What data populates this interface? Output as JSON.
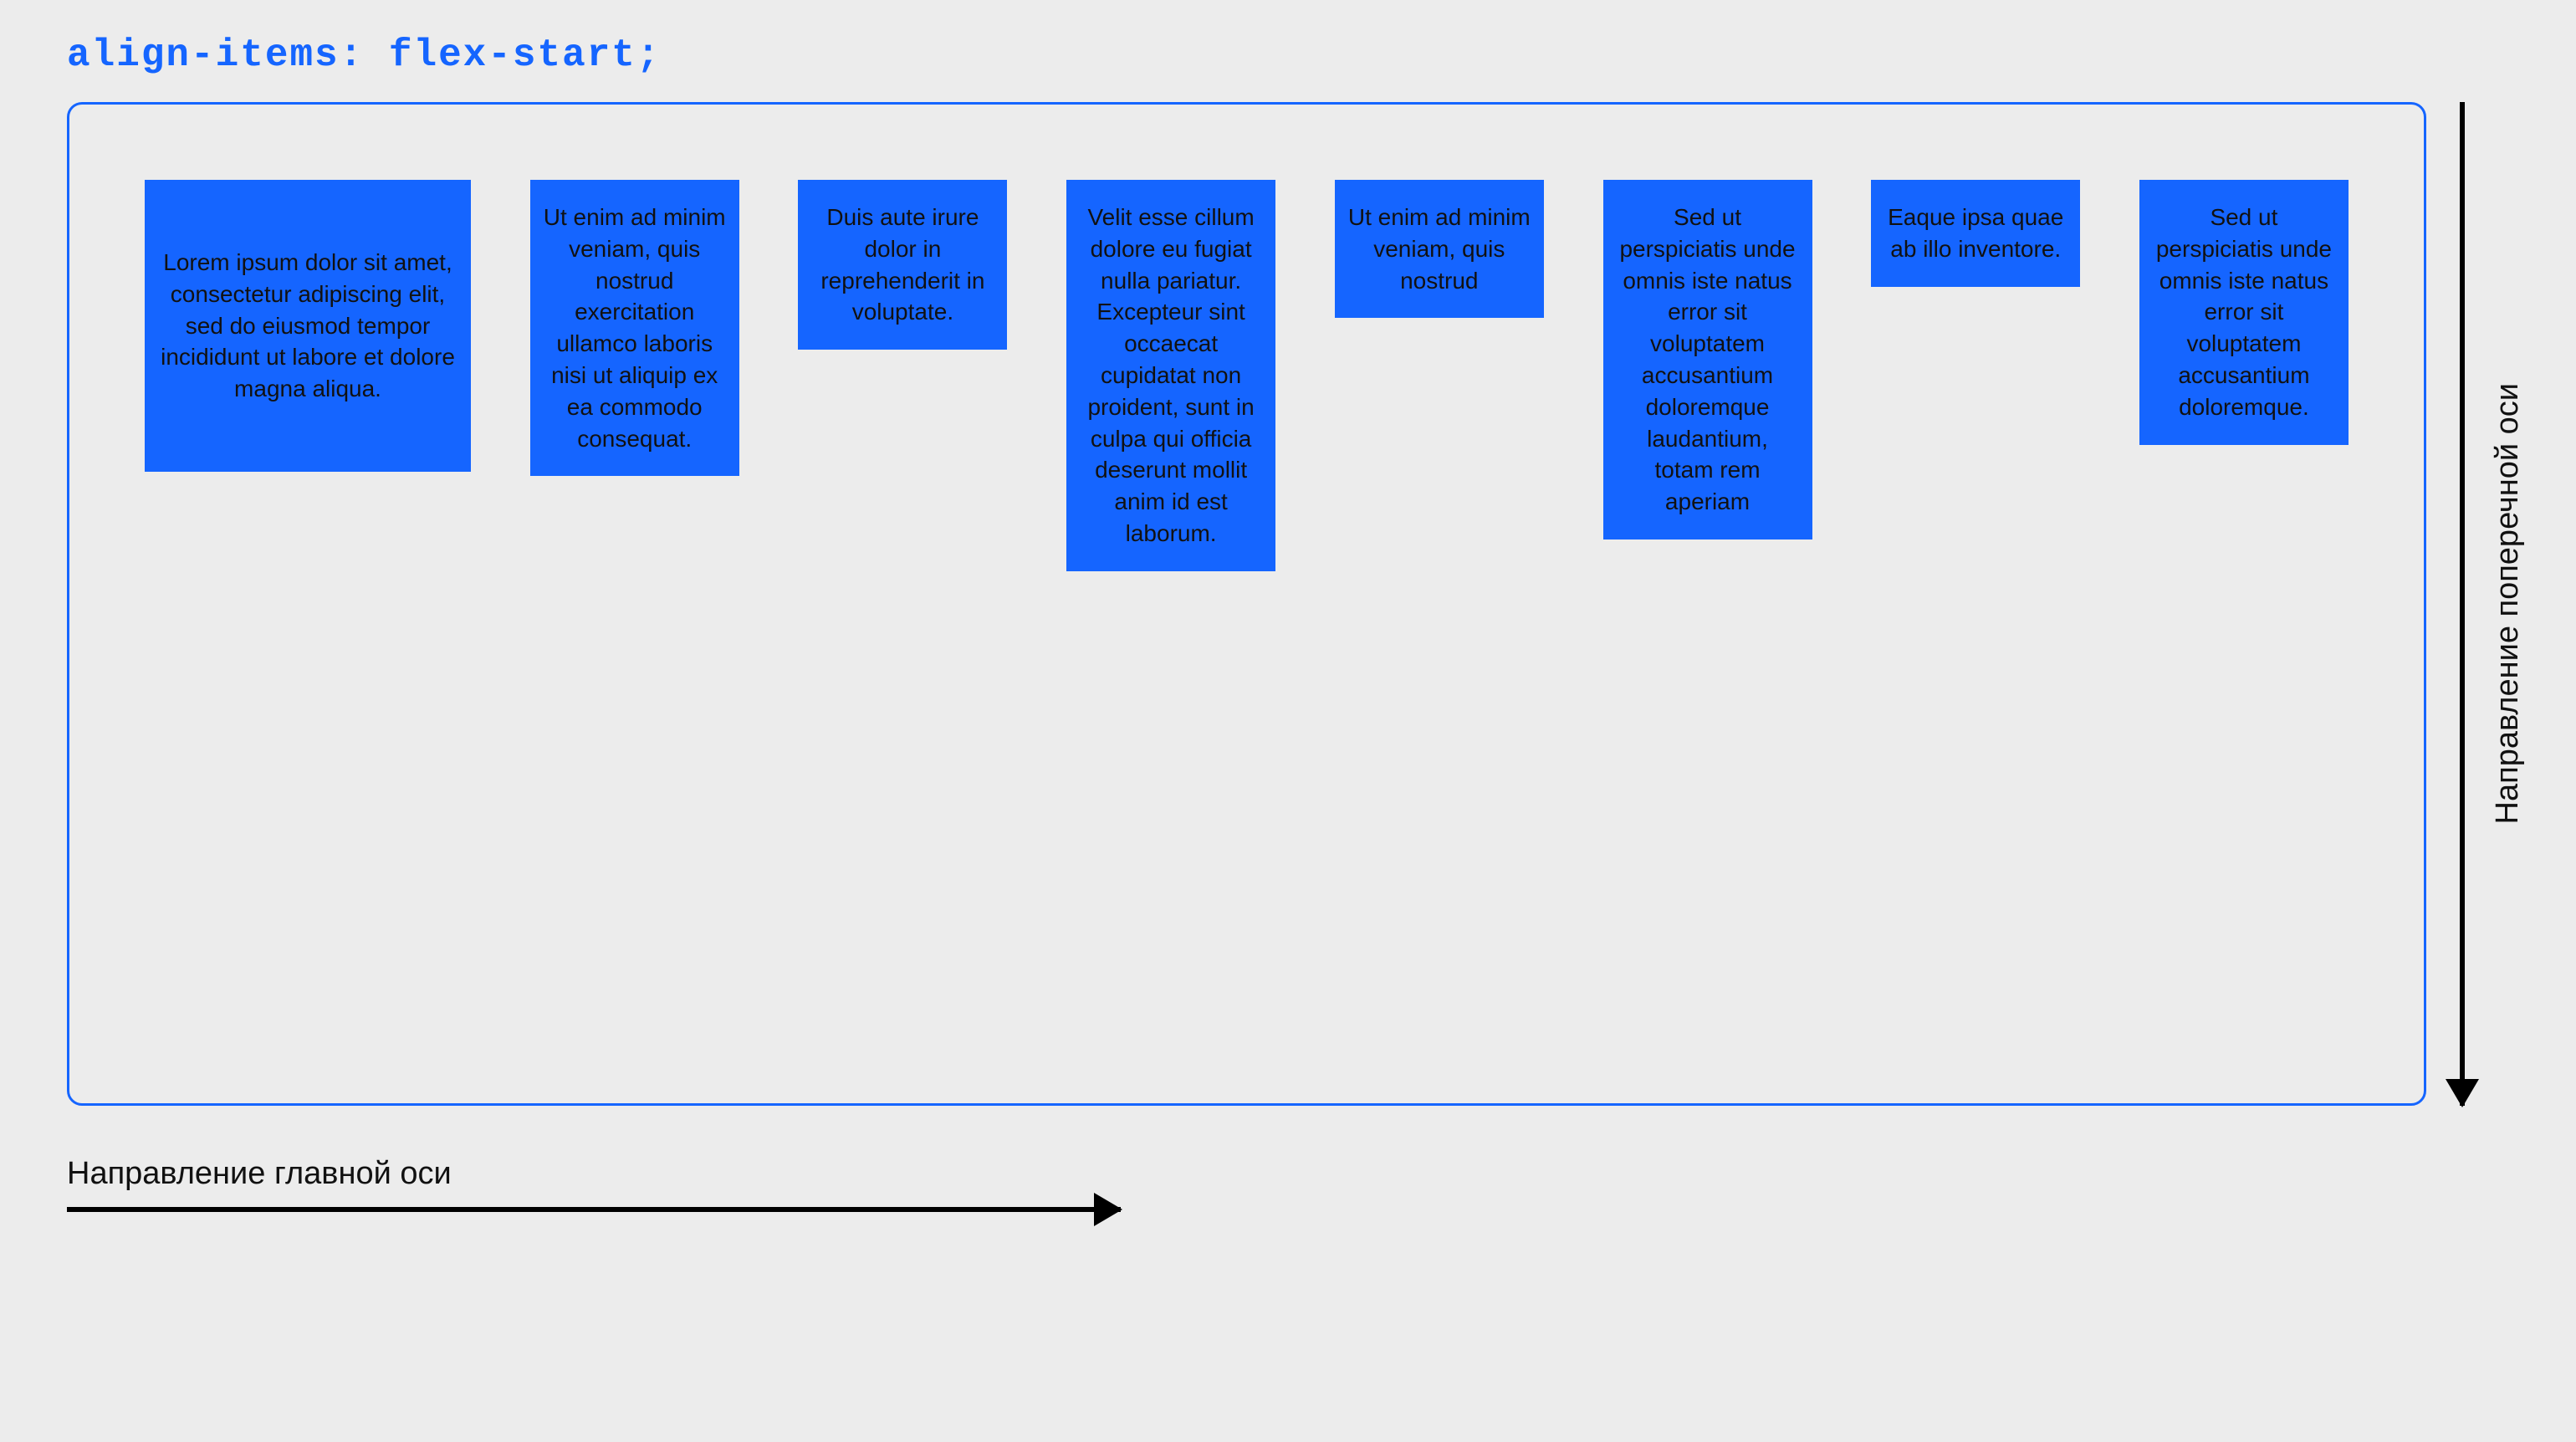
{
  "title": "align-items: flex-start;",
  "mainAxisLabel": "Направление главной оси",
  "crossAxisLabel": "Направление поперечной оси",
  "items": [
    "Lorem ipsum dolor sit amet, consectetur adipiscing elit, sed do eiusmod tempor incididunt ut labore et dolore magna aliqua.",
    "Ut enim ad minim veniam, quis nostrud exercitation ullamco laboris nisi ut aliquip ex ea commodo consequat.",
    "Duis aute irure dolor in reprehenderit in voluptate.",
    "Velit esse cillum dolore eu fugiat nulla pariatur. Excepteur sint occaecat cupidatat non proident, sunt in culpa qui officia deserunt mollit anim id est laborum.",
    "Ut enim ad minim veniam, quis nostrud",
    "Sed ut perspiciatis unde omnis iste natus error sit voluptatem accusantium doloremque laudantium, totam rem aperiam",
    "Eaque ipsa quae ab illo inventore.",
    "Sed ut perspiciatis unde omnis iste natus error sit voluptatem accusantium doloremque."
  ]
}
